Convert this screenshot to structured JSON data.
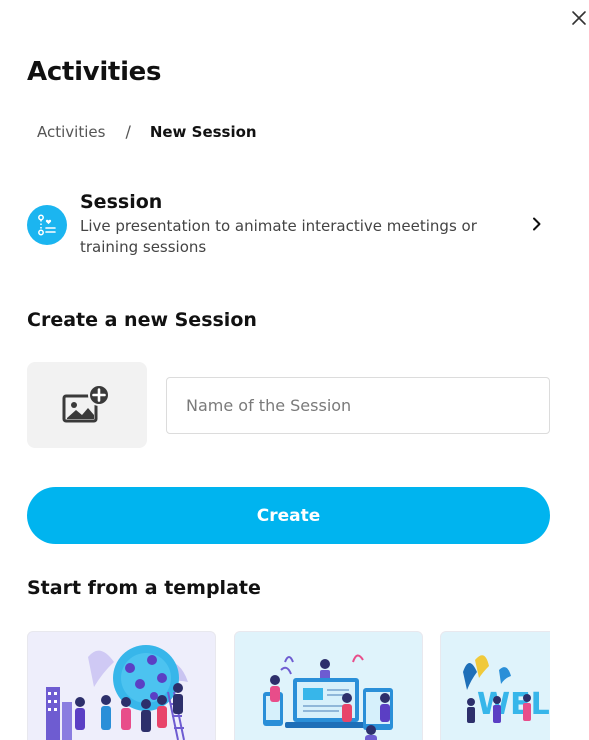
{
  "page": {
    "title": "Activities"
  },
  "breadcrumb": {
    "parent": "Activities",
    "separator": "/",
    "current": "New Session"
  },
  "session_type": {
    "title": "Session",
    "description": "Live presentation to animate interactive meetings or training sessions",
    "icon": "session-flow-icon"
  },
  "create_section": {
    "heading": "Create a new Session",
    "name_placeholder": "Name of the Session",
    "name_value": "",
    "create_label": "Create"
  },
  "templates": {
    "heading": "Start from a template",
    "items": [
      {
        "name": "team-brainstorm-illustration",
        "bg": "#eeeefb"
      },
      {
        "name": "online-collaboration-illustration",
        "bg": "#dff3fb"
      },
      {
        "name": "welcome-illustration",
        "bg": "#dff3fb"
      }
    ]
  },
  "colors": {
    "accent": "#00b4ef",
    "icon_bg": "#1bb5f0"
  }
}
